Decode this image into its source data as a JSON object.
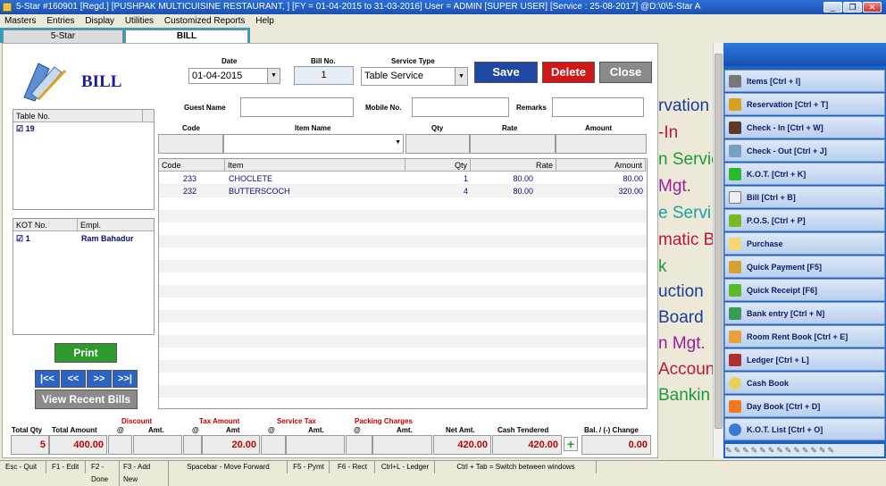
{
  "window": {
    "title": "5-Star #160901  [Regd.]  [PUSHPAK MULTICUISINE RESTAURANT, ]  [FY = 01-04-2015 to 31-03-2016]  User = ADMIN [SUPER USER]   [Service : 25-08-2017]   @D:\\0\\5-Star A"
  },
  "menu": [
    "Masters",
    "Entries",
    "Display",
    "Utilities",
    "Customized Reports",
    "Help"
  ],
  "tabs": [
    "5-Star",
    "BILL"
  ],
  "header": {
    "title": "BILL",
    "date_label": "Date",
    "date_value": "01-04-2015",
    "billno_label": "Bill No.",
    "billno_value": "1",
    "service_label": "Service Type",
    "service_value": "Table Service",
    "save": "Save",
    "delete": "Delete",
    "close": "Close",
    "guest_label": "Guest Name",
    "mobile_label": "Mobile No.",
    "remarks_label": "Remarks"
  },
  "entry": {
    "code": "Code",
    "item": "Item Name",
    "qty": "Qty",
    "rate": "Rate",
    "amount": "Amount"
  },
  "table_no": {
    "header": "Table No.",
    "value": "19"
  },
  "kot": {
    "col1": "KOT No.",
    "col2": "Empl.",
    "no": "1",
    "empl": "Ram Bahadur"
  },
  "items": {
    "headers": [
      "Code",
      "Item",
      "Qty",
      "Rate",
      "Amount"
    ],
    "rows": [
      {
        "code": "233",
        "item": "CHOCLETE",
        "qty": "1",
        "rate": "80.00",
        "amount": "80.00"
      },
      {
        "code": "232",
        "item": "BUTTERSCOCH",
        "qty": "4",
        "rate": "80.00",
        "amount": "320.00"
      }
    ]
  },
  "buttons": {
    "print": "Print",
    "first": "|<<",
    "prev": "<<",
    "next": ">>",
    "last": ">>|",
    "recent": "View Recent Bills"
  },
  "totals": {
    "total_qty_label": "Total Qty",
    "total_qty": "5",
    "total_amount_label": "Total Amount",
    "total_amount": "400.00",
    "discount_label": "Discount",
    "tax_label": "Tax Amount",
    "service_tax_label": "Service Tax",
    "packing_label": "Packing Charges",
    "at": "@",
    "amt": "Amt.",
    "amt2": "Amt",
    "tax_amt": "20.00",
    "net_label": "Net Amt.",
    "net": "420.00",
    "cash_label": "Cash Tendered",
    "cash": "420.00",
    "bal_label": "Bal. / (-) Change",
    "bal": "0.00"
  },
  "sidebar": [
    "Items [Ctrl + I]",
    "Reservation [Ctrl + T]",
    "Check - In [Ctrl + W]",
    "Check - Out [Ctrl + J]",
    "K.O.T. [Ctrl + K]",
    "Bill [Ctrl + B]",
    "P.O.S. [Ctrl + P]",
    "Purchase",
    "Quick Payment [F5]",
    "Quick Receipt [F6]",
    "Bank entry [Ctrl + N]",
    "Room Rent Book [Ctrl + E]",
    "Ledger [Ctrl + L]",
    "Cash Book",
    "Day Book [Ctrl + D]",
    "K.O.T. List [Ctrl + O]"
  ],
  "background_text": [
    "rvation",
    "-In",
    "n Servic",
    "Mgt.",
    "e Servi",
    "matic B",
    "k",
    "uction",
    "Board",
    "n Mgt.",
    "Accoun",
    "Bankin"
  ],
  "status": [
    "Esc - Quit",
    "F1 - Edit",
    "F2 - Done",
    "F3 - Add New",
    "Spacebar - Move Forward",
    "F5 - Pymt",
    "F6 - Rect",
    "Ctrl+L - Ledger",
    "Ctrl + Tab = Switch between windows"
  ]
}
